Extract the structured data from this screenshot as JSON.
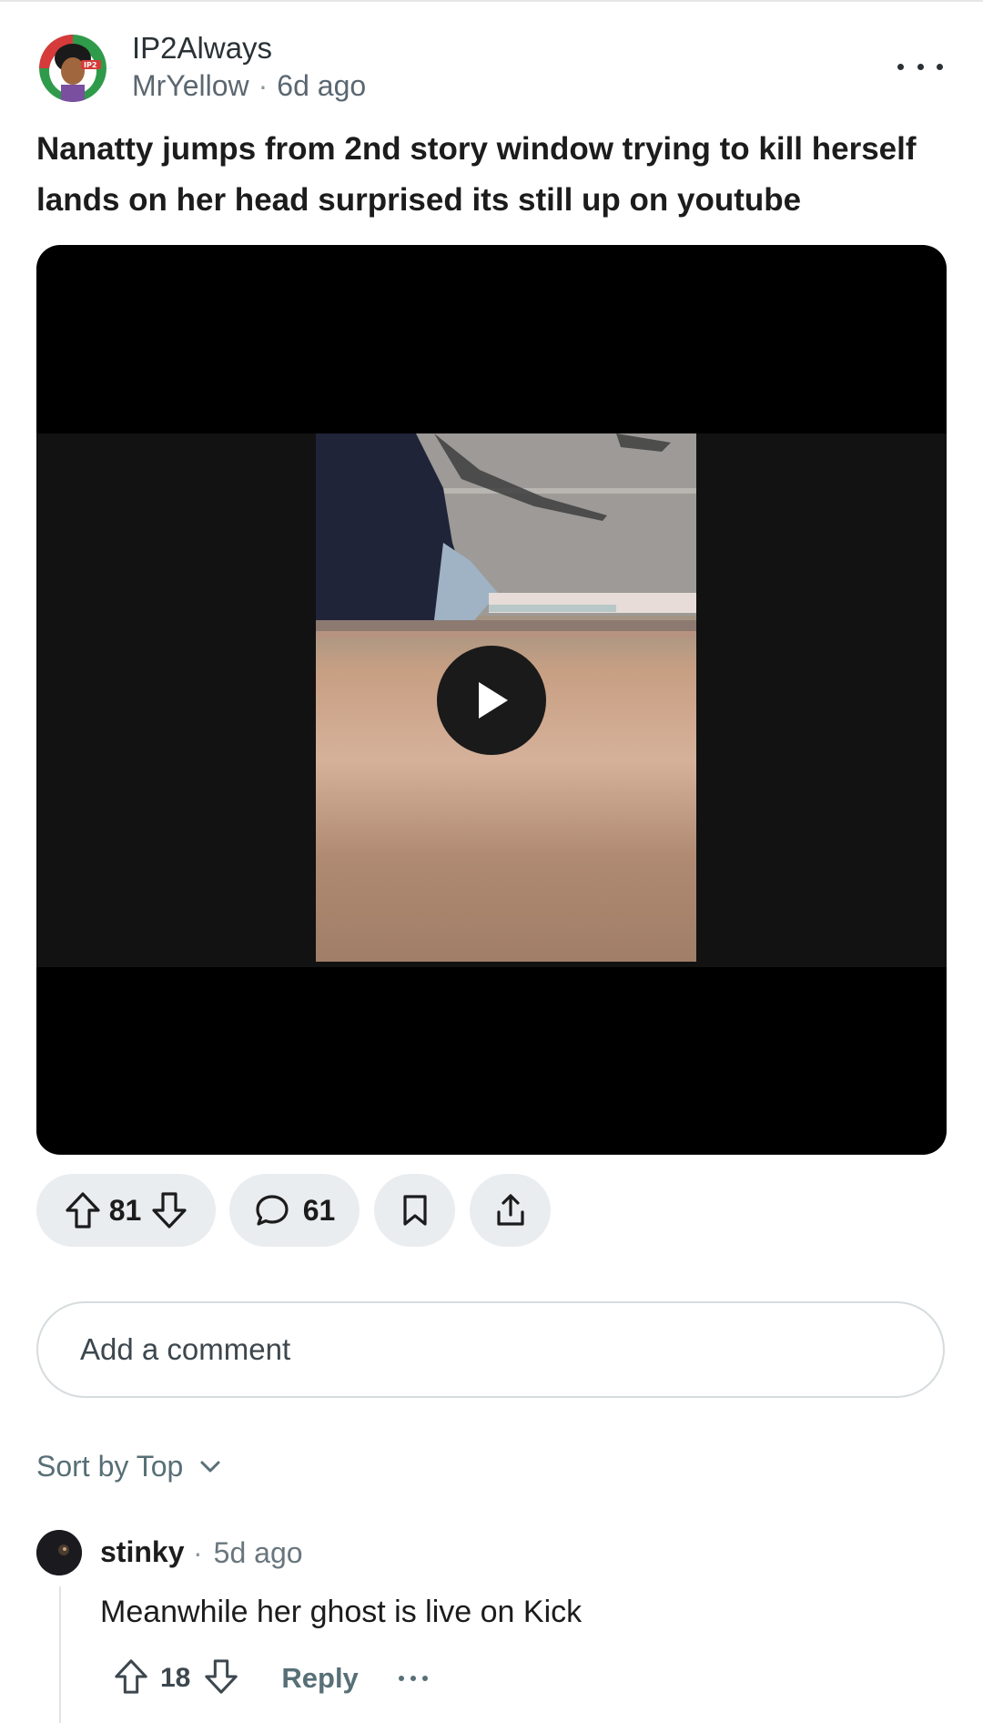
{
  "post": {
    "community": "IP2Always",
    "author": "MrYellow",
    "separator": "·",
    "time": "6d ago",
    "title": "Nanatty jumps from 2nd story window trying to kill herself lands on her head surprised its still up on youtube",
    "avatar_badge": "IP2"
  },
  "actions": {
    "upvotes": "81",
    "comments": "61"
  },
  "comment_input": {
    "placeholder": "Add a comment"
  },
  "sort": {
    "label": "Sort by Top"
  },
  "comments": [
    {
      "author": "stinky",
      "separator": "·",
      "time": "5d ago",
      "body": "Meanwhile her ghost is live on Kick",
      "votes": "18",
      "reply_label": "Reply"
    }
  ],
  "icons": {
    "more": "more-horizontal-icon",
    "play": "play-icon",
    "upvote": "arrow-up-icon",
    "downvote": "arrow-down-icon",
    "comment": "comment-bubble-icon",
    "save": "bookmark-icon",
    "share": "share-icon",
    "sort": "chevron-down-icon"
  },
  "colors": {
    "pill_bg": "#eaedef",
    "sort_text": "#576f76",
    "media_bg": "#000000"
  }
}
